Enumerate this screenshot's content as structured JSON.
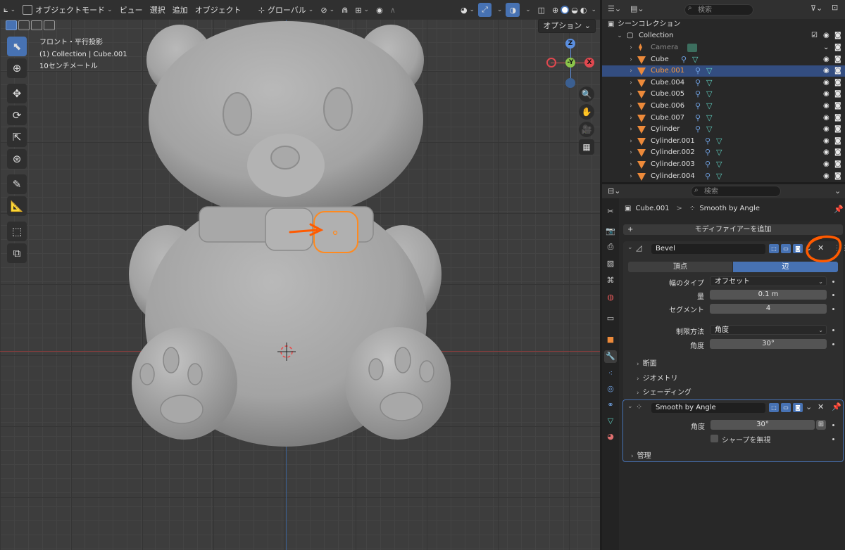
{
  "viewport": {
    "mode_label": "オブジェクトモード",
    "menu": [
      "ビュー",
      "選択",
      "追加",
      "オブジェクト"
    ],
    "orientation": "グローバル",
    "options_label": "オプション",
    "info_lines": [
      "フロント・平行投影",
      "(1) Collection | Cube.001",
      "10センチメートル"
    ],
    "gizmo": {
      "y_label": "-Y",
      "x_label": "X",
      "z_label": "Z"
    }
  },
  "outliner": {
    "search_placeholder": "検索",
    "scene_collection": "シーンコレクション",
    "collection": "Collection",
    "objects": [
      {
        "name": "Camera",
        "type": "camera"
      },
      {
        "name": "Cube"
      },
      {
        "name": "Cube.001",
        "selected": true
      },
      {
        "name": "Cube.004"
      },
      {
        "name": "Cube.005"
      },
      {
        "name": "Cube.006"
      },
      {
        "name": "Cube.007"
      },
      {
        "name": "Cylinder"
      },
      {
        "name": "Cylinder.001"
      },
      {
        "name": "Cylinder.002"
      },
      {
        "name": "Cylinder.003"
      },
      {
        "name": "Cylinder.004"
      }
    ]
  },
  "properties": {
    "search_placeholder": "検索",
    "breadcrumb_object": "Cube.001",
    "breadcrumb_sep": ">",
    "breadcrumb_modifier": "Smooth by Angle",
    "add_modifier_label": "モディファイアーを追加",
    "bevel": {
      "name": "Bevel",
      "tab_vertex": "頂点",
      "tab_edge": "辺",
      "width_type_label": "幅のタイプ",
      "width_type_value": "オフセット",
      "amount_label": "量",
      "amount_value": "0.1 m",
      "segments_label": "セグメント",
      "segments_value": "4",
      "limit_method_label": "制限方法",
      "limit_method_value": "角度",
      "angle_label": "角度",
      "angle_value": "30°",
      "sub_profile": "断面",
      "sub_geometry": "ジオメトリ",
      "sub_shading": "シェーディング"
    },
    "smooth": {
      "name": "Smooth by Angle",
      "angle_label": "角度",
      "angle_value": "30°",
      "ignore_sharp_label": "シャープを無視",
      "manage_label": "管理"
    }
  },
  "colors": {
    "accent": "#4772b3",
    "selection": "#ff9b3d",
    "annotation": "#ff6a00"
  }
}
